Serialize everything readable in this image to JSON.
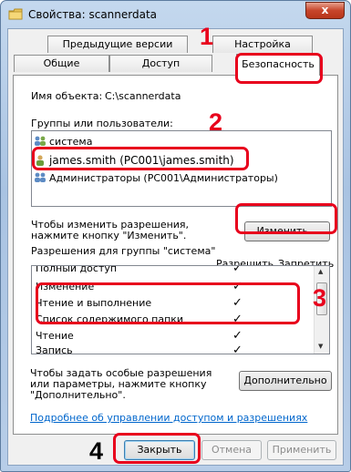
{
  "window": {
    "title": "Свойства: scannerdata",
    "close_label": "x"
  },
  "tabs_row1": [
    {
      "label": "Предыдущие версии"
    },
    {
      "label": "Настройка"
    }
  ],
  "tabs_row2": [
    {
      "label": "Общие"
    },
    {
      "label": "Доступ"
    },
    {
      "label": "Безопасность"
    }
  ],
  "object": {
    "label": "Имя объекта:",
    "value": "C:\\scannerdata"
  },
  "groups": {
    "label": "Группы или пользователи:",
    "items": [
      {
        "label": "система"
      },
      {
        "label": "james.smith (PC001\\james.smith)"
      },
      {
        "label": "Администраторы (PC001\\Администраторы)"
      }
    ]
  },
  "change_hint": "Чтобы изменить разрешения, нажмите кнопку \"Изменить\".",
  "change_button": "Изменить...",
  "perms": {
    "heading": "Разрешения для группы \"система\"",
    "allow_header": "Разрешить",
    "deny_header": "Запретить",
    "rows": [
      {
        "name": "Полный доступ",
        "allow": "✓"
      },
      {
        "name": "Изменение",
        "allow": "✓"
      },
      {
        "name": "Чтение и выполнение",
        "allow": "✓"
      },
      {
        "name": "Список содержимого папки",
        "allow": "✓"
      },
      {
        "name": "Чтение",
        "allow": "✓"
      },
      {
        "name": "Запись",
        "allow": "✓"
      }
    ]
  },
  "special_hint": "Чтобы задать особые разрешения или параметры, нажмите кнопку \"Дополнительно\".",
  "advanced_button": "Дополнительно",
  "link": "Подробнее об управлении доступом и разрешениях",
  "footer": {
    "close": "Закрыть",
    "cancel": "Отмена",
    "apply": "Применить"
  },
  "steps": {
    "s1": "1",
    "s2": "2",
    "s3": "3",
    "s4": "4"
  },
  "colors": {
    "callout": "#e8001c",
    "link": "#0066cc"
  }
}
